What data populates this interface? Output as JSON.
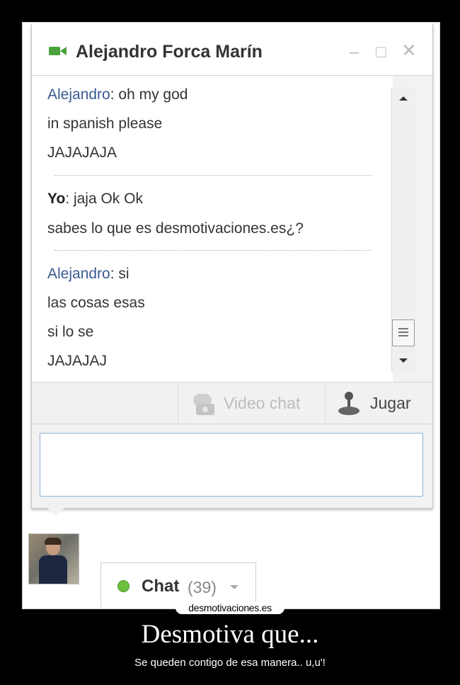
{
  "window": {
    "title": "Alejandro Forca Marín",
    "controls": {
      "minimize": "–",
      "maximize": "□",
      "close": "✕"
    }
  },
  "messages": [
    {
      "sender": "Alejandro",
      "lines": [
        "oh my god",
        "in spanish please",
        "JAJAJAJA"
      ]
    },
    {
      "sender": "Yo",
      "lines": [
        "jaja Ok Ok",
        "sabes lo que es desmotivaciones.es¿?"
      ]
    },
    {
      "sender": "Alejandro",
      "lines": [
        "si",
        "las cosas esas",
        "si lo se",
        "JAJAJAJ"
      ]
    }
  ],
  "toolbar": {
    "video_chat": "Video chat",
    "play": "Jugar"
  },
  "input": {
    "value": ""
  },
  "chat_button": {
    "label": "Chat",
    "count": "(39)"
  },
  "watermark": "desmotivaciones.es",
  "caption": {
    "title": "Desmotiva que...",
    "subtitle": "Se queden contigo de esa manera.. u,u'!"
  },
  "icons": [
    "video-camera-icon",
    "webcam-icon",
    "joystick-icon",
    "online-status-icon",
    "chevron-down-icon"
  ],
  "colors": {
    "sender_accent": "#3b5a8f",
    "online": "#6fbf3f",
    "input_border": "#8fb2d6"
  }
}
